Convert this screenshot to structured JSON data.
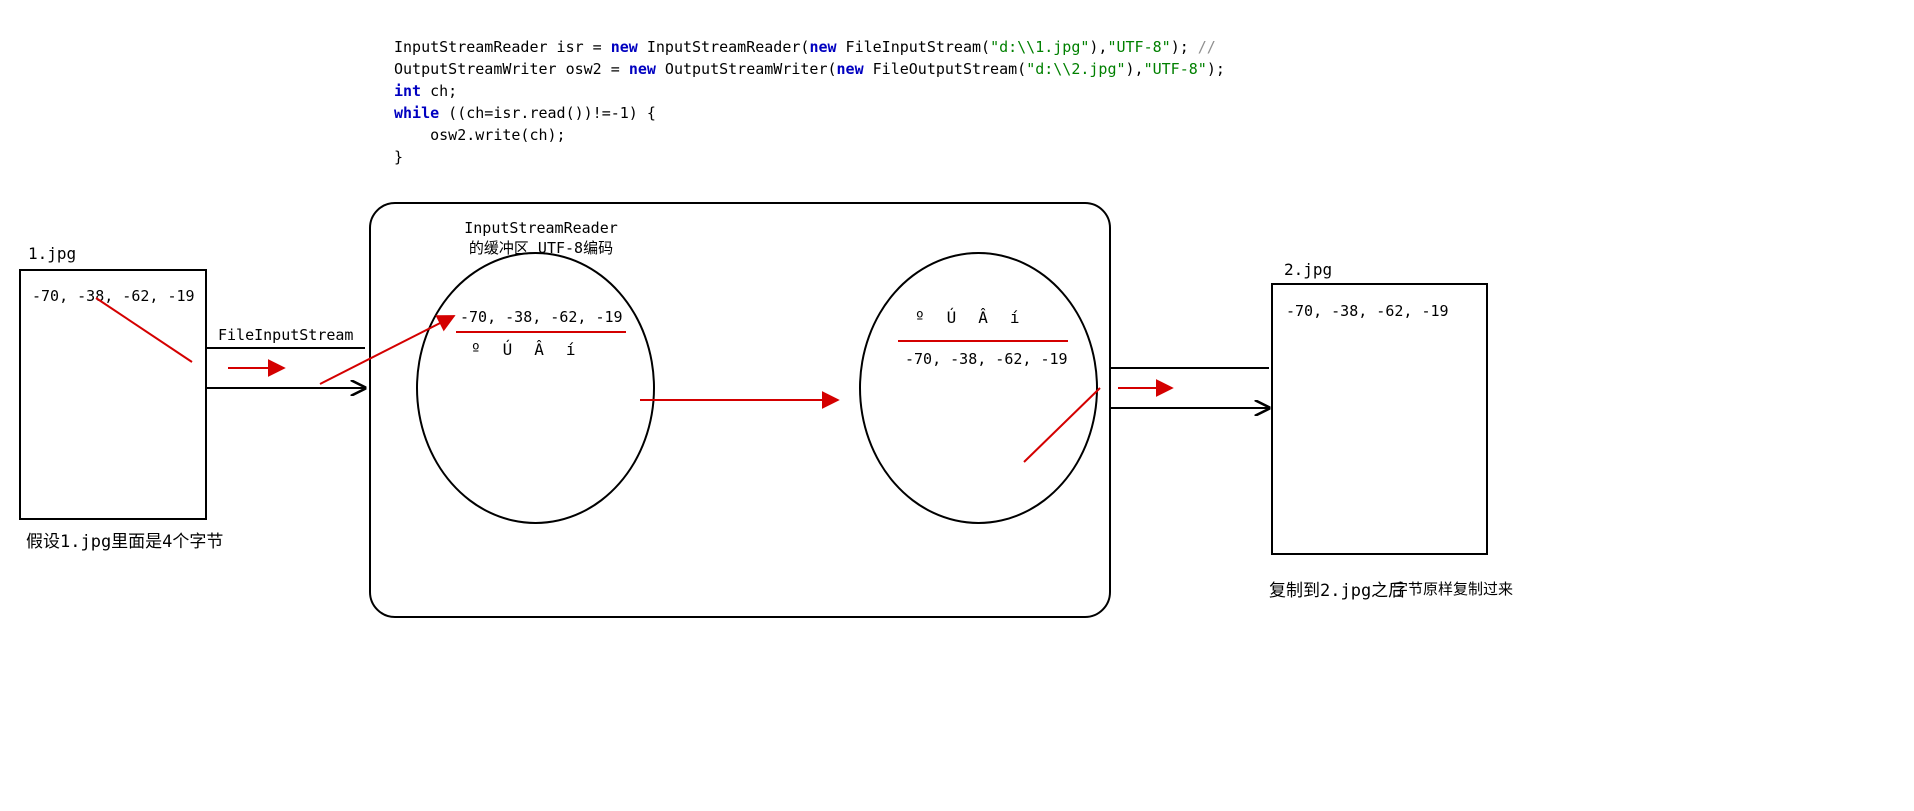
{
  "code": {
    "line1_a": "InputStreamReader isr = ",
    "line1_new1": "new",
    "line1_b": " InputStreamReader(",
    "line1_new2": "new",
    "line1_c": " FileInputStream(",
    "line1_s1": "\"d:\\\\1.jpg\"",
    "line1_d": "),",
    "line1_s2": "\"UTF-8\"",
    "line1_e": "); ",
    "line1_cmt": "//",
    "line2_a": "OutputStreamWriter osw2 = ",
    "line2_new1": "new",
    "line2_b": " OutputStreamWriter(",
    "line2_new2": "new",
    "line2_c": " FileOutputStream(",
    "line2_s1": "\"d:\\\\2.jpg\"",
    "line2_d": "),",
    "line2_s2": "\"UTF-8\"",
    "line2_e": ");",
    "line3_kw": "int",
    "line3_rest": " ch;",
    "line4_kw": "while",
    "line4_rest": " ((ch=isr.read())!=-1) {",
    "line5": "    osw2.write(ch);",
    "line6": "}"
  },
  "left": {
    "title": "1.jpg",
    "bytes": "-70, -38, -62, -19",
    "caption": "假设1.jpg里面是4个字节"
  },
  "streamLabel": "FileInputStream",
  "buffer": {
    "title_l1": "InputStreamReader",
    "title_l2": "的缓冲区 UTF-8编码",
    "bytes": "-70, -38, -62,  -19",
    "chars": "ºÚÂí"
  },
  "decode": {
    "chars": "ºÚÂí",
    "bytes": "-70, -38, -62,  -19"
  },
  "right": {
    "title": "2.jpg",
    "bytes": "-70, -38, -62,  -19",
    "caption_a": "复制到2.jpg之后",
    "caption_b": "字节原样复制过来"
  }
}
